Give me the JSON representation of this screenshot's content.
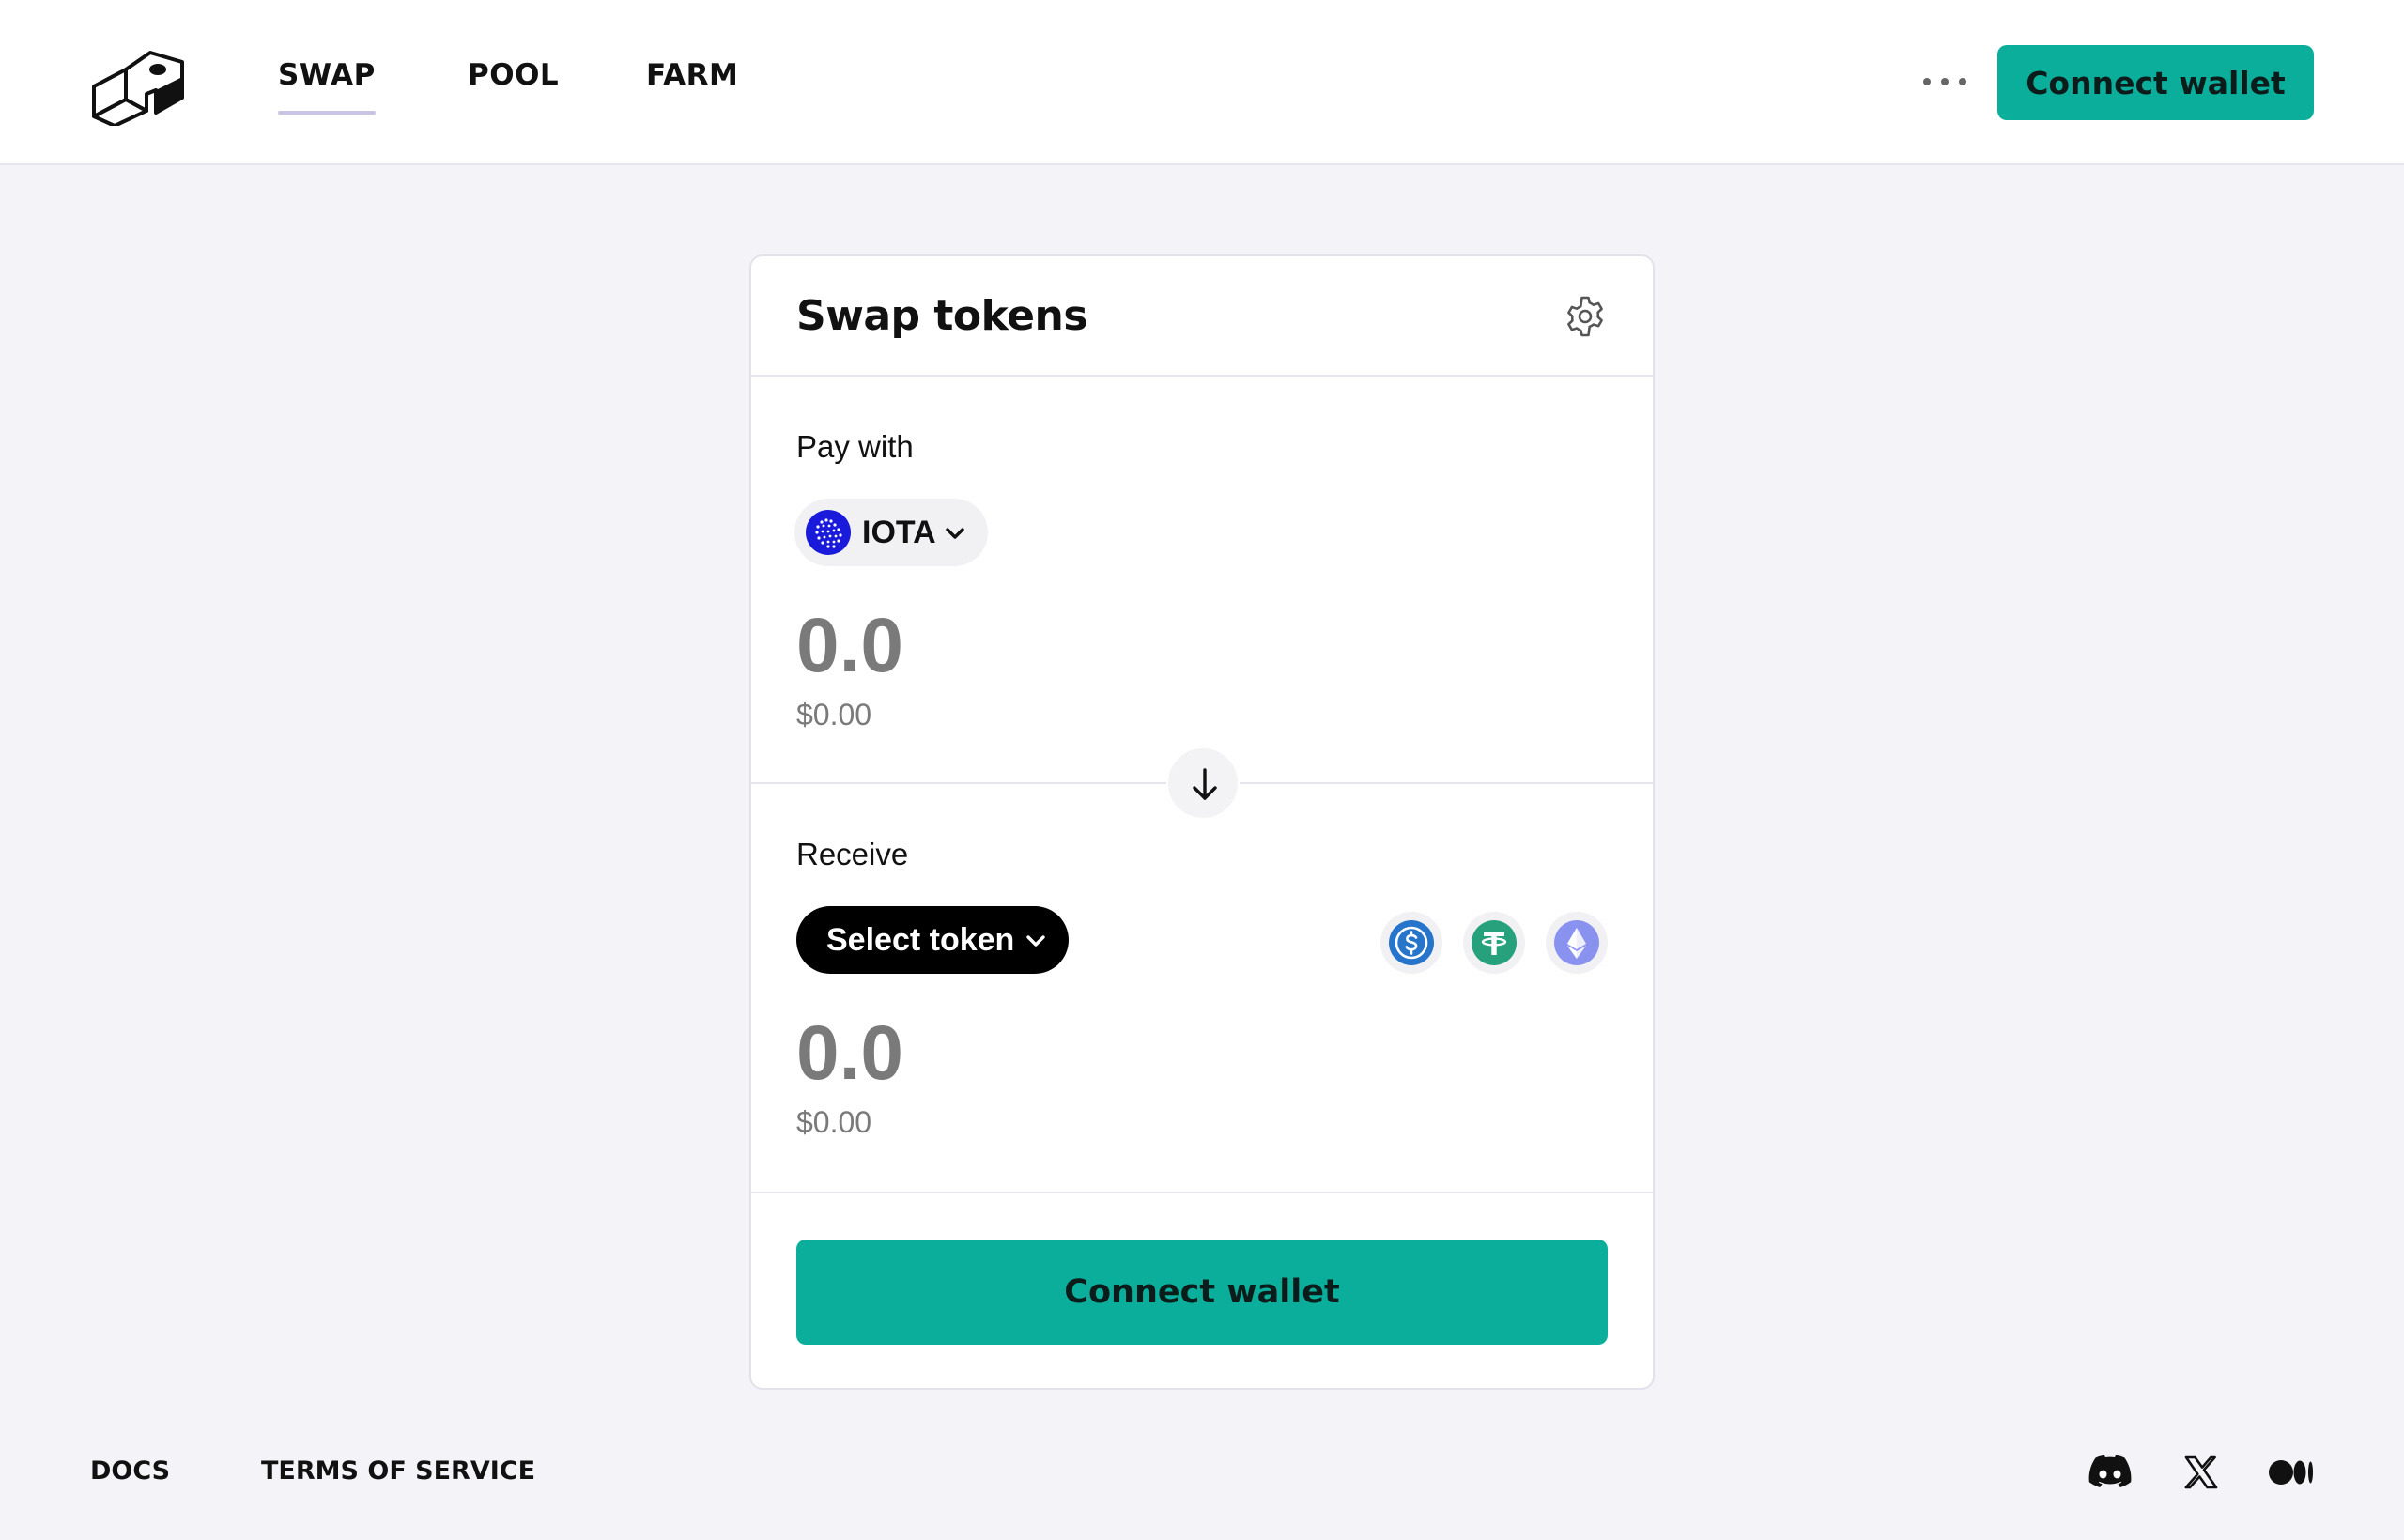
{
  "nav": {
    "items": [
      {
        "label": "SWAP",
        "active": true
      },
      {
        "label": "POOL",
        "active": false
      },
      {
        "label": "FARM",
        "active": false
      }
    ],
    "more_icon": "more-horizontal-icon",
    "connect_label": "Connect wallet"
  },
  "swap": {
    "title": "Swap tokens",
    "settings_icon": "gear-icon",
    "pay": {
      "label": "Pay with",
      "token": "IOTA",
      "amount": "0.0",
      "usd": "$0.00"
    },
    "receive": {
      "label": "Receive",
      "select_label": "Select token",
      "amount": "0.0",
      "usd": "$0.00",
      "quick_tokens": [
        "usdc-icon",
        "usdt-icon",
        "eth-icon"
      ]
    },
    "connect_label": "Connect wallet"
  },
  "footer": {
    "links": [
      "DOCS",
      "TERMS OF SERVICE"
    ],
    "socials": [
      "discord-icon",
      "x-icon",
      "medium-icon"
    ]
  },
  "colors": {
    "accent": "#0bae9b",
    "background": "#f4f3f7",
    "iota": "#1a1adb"
  }
}
